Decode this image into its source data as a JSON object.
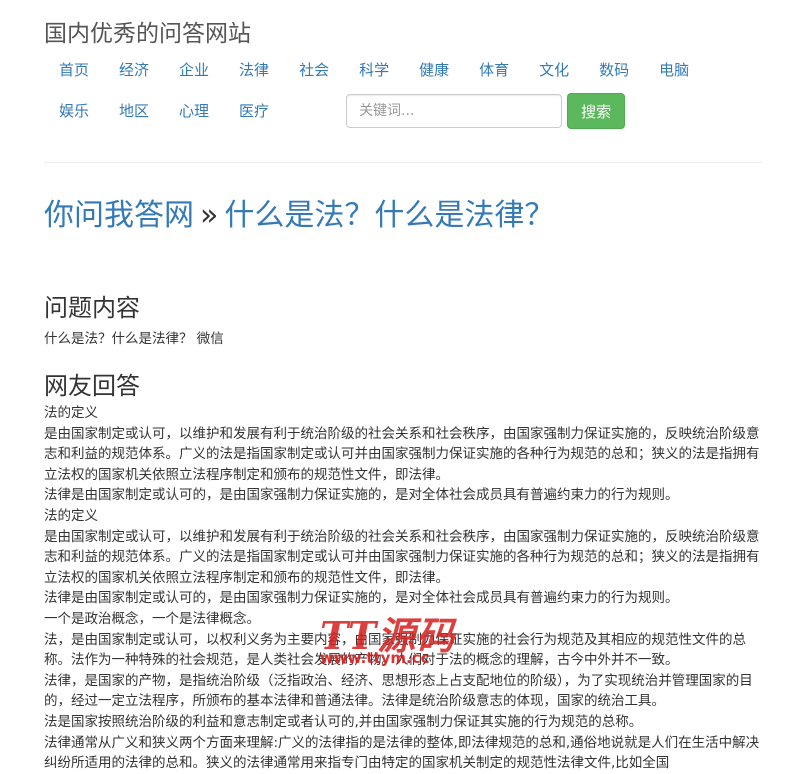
{
  "site": {
    "title": "国内优秀的问答网站"
  },
  "nav": {
    "row1": [
      "首页",
      "经济",
      "企业",
      "法律",
      "社会",
      "科学",
      "健康",
      "体育",
      "文化",
      "数码",
      "电脑"
    ],
    "row2": [
      "娱乐",
      "地区",
      "心理",
      "医疗"
    ]
  },
  "search": {
    "placeholder": "关键词...",
    "button": "搜索"
  },
  "breadcrumb": {
    "site": "你问我答网",
    "separator": "»",
    "question": "什么是法？什么是法律？"
  },
  "question": {
    "heading": "问题内容",
    "text": "什么是法？什么是法律？ 微信"
  },
  "answers": {
    "heading": "网友回答",
    "paragraphs": [
      "法的定义",
      "是由国家制定或认可，以维护和发展有利于统治阶级的社会关系和社会秩序，由国家强制力保证实施的，反映统治阶级意志和利益的规范体系。广义的法是指国家制定或认可并由国家强制力保证实施的各种行为规范的总和；狭义的法是指拥有立法权的国家机关依照立法程序制定和颁布的规范性文件，即法律。",
      "法律是由国家制定或认可的，是由国家强制力保证实施的，是对全体社会成员具有普遍约束力的行为规则。",
      "法的定义",
      "是由国家制定或认可，以维护和发展有利于统治阶级的社会关系和社会秩序，由国家强制力保证实施的，反映统治阶级意志和利益的规范体系。广义的法是指国家制定或认可并由国家强制力保证实施的各种行为规范的总和；狭义的法是指拥有立法权的国家机关依照立法程序制定和颁布的规范性文件，即法律。",
      "法律是由国家制定或认可的，是由国家强制力保证实施的，是对全体社会成员具有普遍约束力的行为规则。",
      "一个是政治概念，一个是法律概念。",
      "法，是由国家制定或认可，以权利义务为主要内容，由国家强制力保证实施的社会行为规范及其相应的规范性文件的总称。法作为一种特殊的社会规范，是人类社会发展的产物。人们对于法的概念的理解，古今中外并不一致。",
      "法律，是国家的产物，是指统治阶级（泛指政治、经济、思想形态上占支配地位的阶级），为了实现统治并管理国家的目的，经过一定立法程序，所颁布的基本法律和普通法律。法律是统治阶级意志的体现，国家的统治工具。",
      "法是国家按照统治阶级的利益和意志制定或者认可的,并由国家强制力保证其实施的行为规范的总称。",
      "法律通常从广义和狭义两个方面来理解:广义的法律指的是法律的整体,即法律规范的总和,通俗地说就是人们在生活中解决纠纷所适用的法律的总和。狭义的法律通常用来指专门由特定的国家机关制定的规范性法律文件,比如全国"
    ]
  },
  "watermark": {
    "text": "TT源码",
    "url": "www.ttym.cc"
  }
}
